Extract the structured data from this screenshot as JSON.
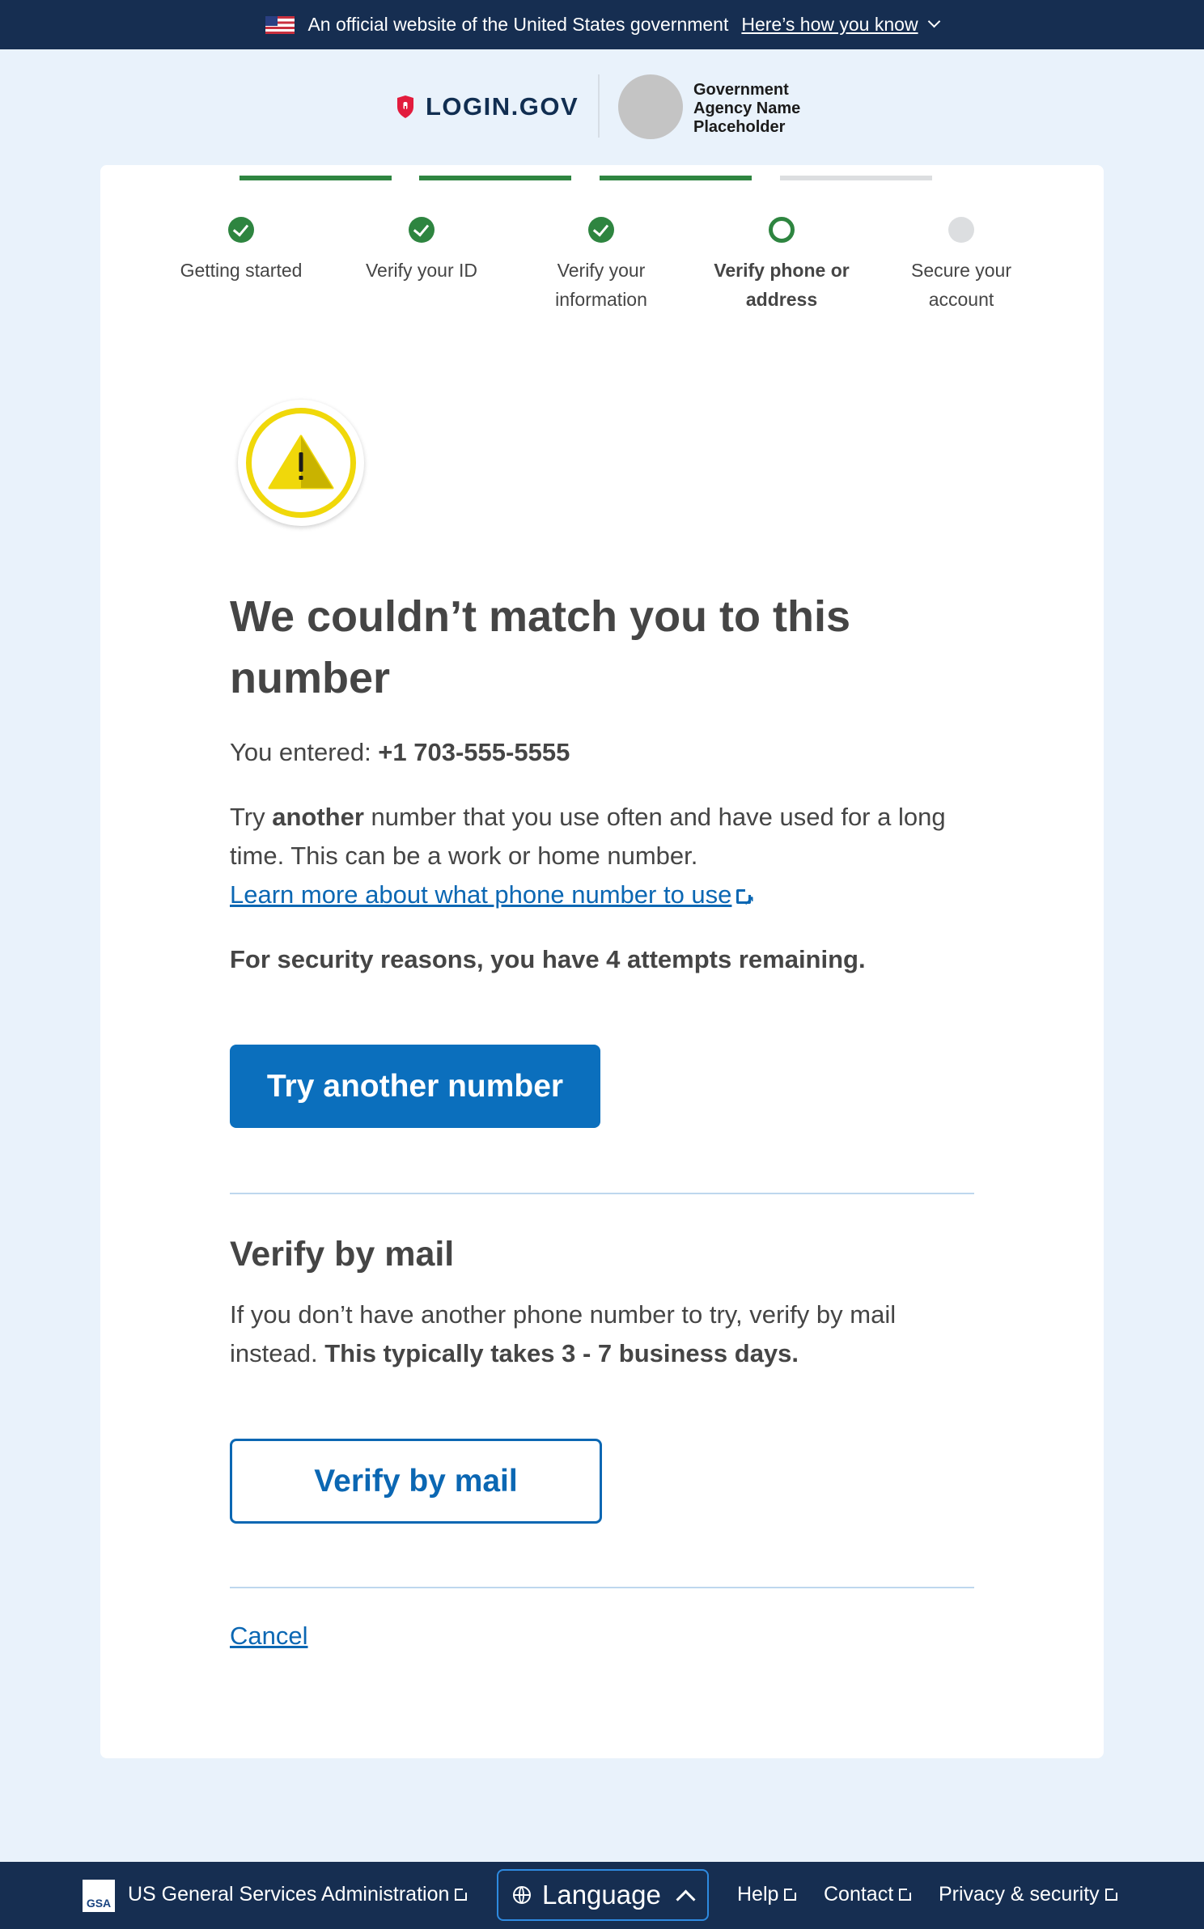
{
  "banner": {
    "text": "An official website of the United States government",
    "link": "Here’s how you know"
  },
  "header": {
    "logo": "LOGIN.GOV",
    "agency_lines": [
      "Government",
      "Agency Name",
      "Placeholder"
    ]
  },
  "steps": [
    {
      "line1": "Getting started",
      "line2": "",
      "status": "complete"
    },
    {
      "line1": "Verify your ID",
      "line2": "",
      "status": "complete"
    },
    {
      "line1": "Verify your",
      "line2": "information",
      "status": "complete"
    },
    {
      "line1": "Verify phone or",
      "line2": "address",
      "status": "current"
    },
    {
      "line1": "Secure your",
      "line2": "account",
      "status": "incomplete"
    }
  ],
  "main": {
    "icon": "warning-icon",
    "title": "We couldn’t match you to this number",
    "entered_label": "You entered: ",
    "entered_number": "+1 703-555-5555",
    "try_prefix": "Try ",
    "try_bold": "another",
    "try_rest": " number that you use often and have used for a long time. This can be a work or home number.",
    "learn_more": "Learn more about what phone number to use",
    "attempts": "For security reasons, you have 4 attempts remaining.",
    "try_button": "Try another number",
    "mail_heading": "Verify by mail",
    "mail_text": "If you don’t have another phone number to try, verify by mail instead. ",
    "mail_bold": "This typically takes 3 - 7 business days.",
    "mail_button": "Verify by mail",
    "cancel": "Cancel"
  },
  "footer": {
    "gsa_logo": "GSA",
    "agency": "US General Services Administration",
    "language": "Language",
    "help": "Help",
    "contact": "Contact",
    "privacy": "Privacy & security"
  },
  "colors": {
    "banner_bg": "#162e51",
    "page_bg": "#e9f2fb",
    "step_green": "#2e8540",
    "primary_blue": "#0b6fbd",
    "link_blue": "#0b67b3",
    "warning_yellow": "#f0d80a"
  }
}
